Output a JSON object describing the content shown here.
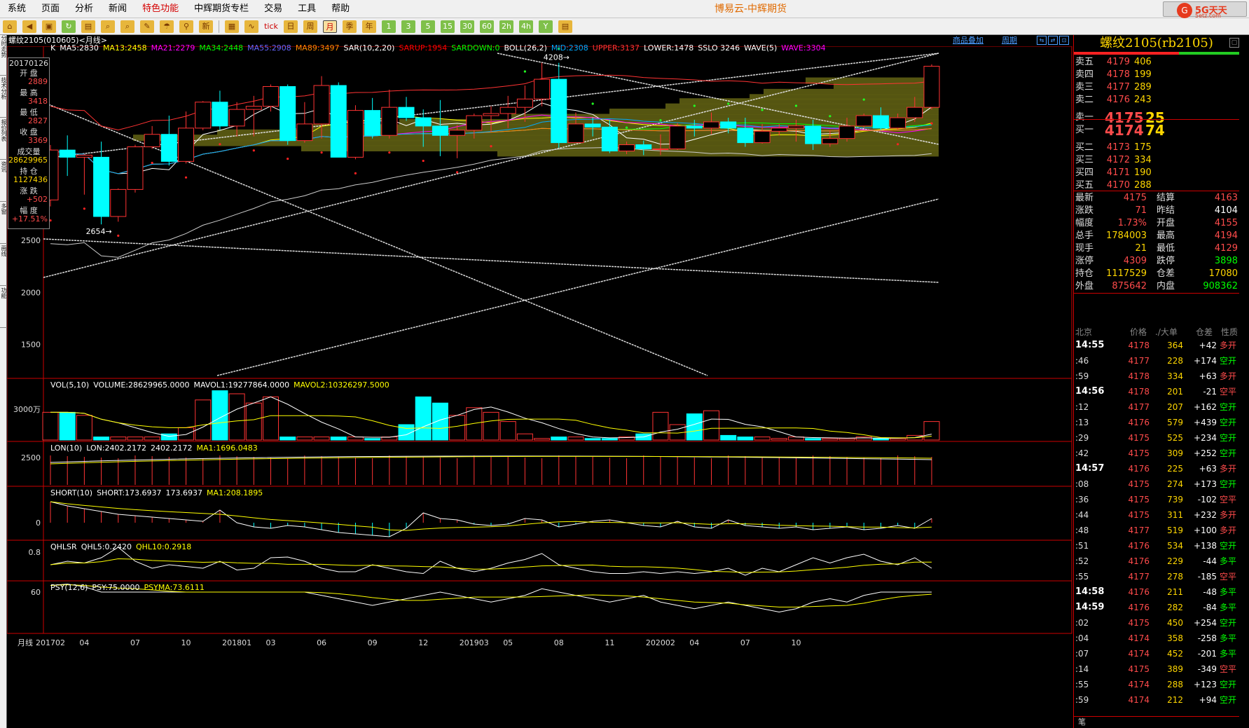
{
  "menu": [
    "系统",
    "页面",
    "分析",
    "新闻",
    "特色功能",
    "中辉期货专栏",
    "交易",
    "工具",
    "帮助"
  ],
  "app_title": "博易云-中辉期货",
  "brand": {
    "name": "5G天天",
    "url": "5etz.com",
    "logo_letter": "G"
  },
  "toolbar": [
    "⌂",
    "◀",
    "▣",
    "↻",
    "▤",
    "⌕",
    "⌕",
    "✎",
    "☂",
    "⚲",
    "新",
    "▦",
    "∿",
    "tick",
    "日",
    "周",
    "月",
    "季",
    "年",
    "1",
    "3",
    "5",
    "15",
    "30",
    "60",
    "2h",
    "4h",
    "Y",
    "▤"
  ],
  "chart_header": {
    "contract_tag": "螺纹2105(010605)<月线>",
    "overlay_link": "商品叠加",
    "period_link": "周期",
    "nav": [
      "⇆",
      "⇄",
      "⊡"
    ]
  },
  "left_tabs": [
    "分时走势",
    "技术分析",
    "报价列表",
    "资讯",
    "多窗",
    "画线",
    "功能"
  ],
  "info_panel": {
    "date": "20170126",
    "rows": [
      {
        "label": "开 盘",
        "value": "2889"
      },
      {
        "label": "最 高",
        "value": "3418"
      },
      {
        "label": "最 低",
        "value": "2827"
      },
      {
        "label": "收 盘",
        "value": "3369"
      },
      {
        "label": "成交量",
        "value": "28629965"
      },
      {
        "label": "持 仓",
        "value": "1127436"
      },
      {
        "label": "涨 跌",
        "value": "+502"
      },
      {
        "label": "幅 度",
        "value": "+17.51%"
      }
    ]
  },
  "indicators": {
    "main": [
      {
        "text": "K",
        "color": "#ffffff"
      },
      {
        "text": "MA5:2830",
        "color": "#ffffff"
      },
      {
        "text": "MA13:2458",
        "color": "#ffff00"
      },
      {
        "text": "MA21:2279",
        "color": "#ff00ff"
      },
      {
        "text": "MA34:2448",
        "color": "#00ff00"
      },
      {
        "text": "MA55:2908",
        "color": "#6666ff"
      },
      {
        "text": "MA89:3497",
        "color": "#ff8800"
      },
      {
        "text": "SAR(10,2,20)",
        "color": "#ffffff"
      },
      {
        "text": "SARUP:1954",
        "color": "#ff0000"
      },
      {
        "text": "SARDOWN:0",
        "color": "#00ff00"
      },
      {
        "text": "BOLL(26,2)",
        "color": "#ffffff"
      },
      {
        "text": "MID:2308",
        "color": "#00aaff"
      },
      {
        "text": "UPPER:3137",
        "color": "#ff3333"
      },
      {
        "text": "LOWER:1478",
        "color": "#ffffff"
      },
      {
        "text": "SSLO 3246",
        "color": "#ffffff"
      },
      {
        "text": "WAVE(5)",
        "color": "#ffffff"
      },
      {
        "text": "WAVE:3304",
        "color": "#ff00ff"
      }
    ],
    "vol": [
      {
        "text": "VOL(5,10)",
        "color": "#ffffff"
      },
      {
        "text": "VOLUME:28629965.0000",
        "color": "#ffffff"
      },
      {
        "text": "MAVOL1:19277864.0000",
        "color": "#ffffff"
      },
      {
        "text": "MAVOL2:10326297.5000",
        "color": "#ffff00"
      }
    ],
    "lon": [
      {
        "text": "LON(10)",
        "color": "#ffffff"
      },
      {
        "text": "LON:2402.2172",
        "color": "#ffffff"
      },
      {
        "text": "2402.2172",
        "color": "#ffffff"
      },
      {
        "text": "MA1:1696.0483",
        "color": "#ffff00"
      }
    ],
    "short": [
      {
        "text": "SHORT(10)",
        "color": "#ffffff"
      },
      {
        "text": "SHORT:173.6937",
        "color": "#ffffff"
      },
      {
        "text": "173.6937",
        "color": "#ffffff"
      },
      {
        "text": "MA1:208.1895",
        "color": "#ffff00"
      }
    ],
    "qhl": [
      {
        "text": "QHLSR",
        "color": "#ffffff"
      },
      {
        "text": "QHL5:0.2420",
        "color": "#ffffff"
      },
      {
        "text": "QHL10:0.2918",
        "color": "#ffff00"
      }
    ],
    "psy": [
      {
        "text": "PSY(12,6)",
        "color": "#ffffff"
      },
      {
        "text": "PSY:75.0000",
        "color": "#ffffff"
      },
      {
        "text": "PSYMA:73.6111",
        "color": "#ffff00"
      }
    ]
  },
  "chart_data": {
    "type": "candlestick",
    "period": "月线",
    "candles": [
      {
        "o": 2889,
        "h": 3418,
        "c": 3369,
        "l": 2827
      },
      {
        "o": 3369,
        "h": 3510,
        "c": 3300,
        "l": 3120
      },
      {
        "o": 3300,
        "h": 3330,
        "c": 3320,
        "l": 2940
      },
      {
        "o": 3300,
        "h": 3450,
        "c": 2730,
        "l": 2654
      },
      {
        "o": 2730,
        "h": 3000,
        "c": 2990,
        "l": 2680
      },
      {
        "o": 2990,
        "h": 3420,
        "c": 3400,
        "l": 2960
      },
      {
        "o": 3400,
        "h": 3600,
        "c": 3520,
        "l": 3380
      },
      {
        "o": 3520,
        "h": 3700,
        "c": 3260,
        "l": 3220
      },
      {
        "o": 3260,
        "h": 3740,
        "c": 3580,
        "l": 3240
      },
      {
        "o": 3580,
        "h": 3840,
        "c": 3830,
        "l": 3560
      },
      {
        "o": 3830,
        "h": 3940,
        "c": 3600,
        "l": 3560
      },
      {
        "o": 3600,
        "h": 3830,
        "c": 3760,
        "l": 3500
      },
      {
        "o": 3760,
        "h": 3890,
        "c": 3790,
        "l": 3500
      },
      {
        "o": 3790,
        "h": 4000,
        "c": 3980,
        "l": 3740
      },
      {
        "o": 3980,
        "h": 4000,
        "c": 3460,
        "l": 3420
      },
      {
        "o": 3460,
        "h": 3830,
        "c": 3620,
        "l": 3440
      },
      {
        "o": 3620,
        "h": 4080,
        "c": 3990,
        "l": 3480
      },
      {
        "o": 3990,
        "h": 4020,
        "c": 3300,
        "l": 3320
      },
      {
        "o": 3300,
        "h": 3800,
        "c": 3750,
        "l": 3280
      },
      {
        "o": 3750,
        "h": 3870,
        "c": 3510,
        "l": 3480
      },
      {
        "o": 3510,
        "h": 3950,
        "c": 3780,
        "l": 3480
      },
      {
        "o": 3780,
        "h": 3880,
        "c": 3680,
        "l": 3650
      },
      {
        "o": 3680,
        "h": 3760,
        "c": 3600,
        "l": 3400
      },
      {
        "o": 3600,
        "h": 3850,
        "c": 3510,
        "l": 3310
      },
      {
        "o": 3510,
        "h": 3610,
        "c": 3560,
        "l": 3290
      },
      {
        "o": 3560,
        "h": 3720,
        "c": 3700,
        "l": 3480
      },
      {
        "o": 3700,
        "h": 3790,
        "c": 3720,
        "l": 3540
      },
      {
        "o": 3720,
        "h": 3890,
        "c": 3780,
        "l": 3580
      },
      {
        "o": 3780,
        "h": 3990,
        "c": 3860,
        "l": 3640
      },
      {
        "o": 3860,
        "h": 4208,
        "c": 4050,
        "l": 3790
      },
      {
        "o": 4050,
        "h": 4208,
        "c": 3440,
        "l": 3390
      },
      {
        "o": 3440,
        "h": 3730,
        "c": 3620,
        "l": 3440
      },
      {
        "o": 3620,
        "h": 3680,
        "c": 3590,
        "l": 3500
      },
      {
        "o": 3590,
        "h": 3660,
        "c": 3360,
        "l": 3340
      },
      {
        "o": 3360,
        "h": 3450,
        "c": 3420,
        "l": 3330
      },
      {
        "o": 3420,
        "h": 3460,
        "c": 3380,
        "l": 3320
      },
      {
        "o": 3380,
        "h": 3520,
        "c": 3380,
        "l": 3320
      },
      {
        "o": 3380,
        "h": 3630,
        "c": 3600,
        "l": 3370
      },
      {
        "o": 3600,
        "h": 3660,
        "c": 3580,
        "l": 3500
      },
      {
        "o": 3580,
        "h": 3730,
        "c": 3640,
        "l": 3520
      },
      {
        "o": 3640,
        "h": 3680,
        "c": 3580,
        "l": 3530
      },
      {
        "o": 3580,
        "h": 3680,
        "c": 3440,
        "l": 3400
      },
      {
        "o": 3440,
        "h": 3620,
        "c": 3550,
        "l": 3430
      },
      {
        "o": 3550,
        "h": 3620,
        "c": 3580,
        "l": 3510
      },
      {
        "o": 3580,
        "h": 3660,
        "c": 3600,
        "l": 3450
      },
      {
        "o": 3600,
        "h": 3660,
        "c": 3430,
        "l": 3370
      },
      {
        "o": 3430,
        "h": 3560,
        "c": 3480,
        "l": 3400
      },
      {
        "o": 3480,
        "h": 3680,
        "c": 3600,
        "l": 3450
      },
      {
        "o": 3600,
        "h": 3720,
        "c": 3700,
        "l": 3580
      },
      {
        "o": 3700,
        "h": 3780,
        "c": 3580,
        "l": 3560
      },
      {
        "o": 3580,
        "h": 3720,
        "c": 3680,
        "l": 3560
      },
      {
        "o": 3680,
        "h": 3880,
        "c": 3780,
        "l": 3640
      },
      {
        "o": 3780,
        "h": 4194,
        "c": 4175,
        "l": 3760
      }
    ],
    "annotations": [
      {
        "text": "4208→",
        "index": 30
      },
      {
        "text": "2654→",
        "index": 3
      }
    ],
    "y_ticks": [
      "2500",
      "2000",
      "1500"
    ],
    "vol_tick": "3000万",
    "lon_tick": "2500",
    "short_tick": "0",
    "qhl_tick": "0.8",
    "psy_tick": "60",
    "x_labels": [
      "201702",
      "04",
      "07",
      "10",
      "201801",
      "03",
      "06",
      "09",
      "12",
      "201903",
      "05",
      "08",
      "11",
      "202002",
      "04",
      "07",
      "10"
    ],
    "x_label_index": [
      0,
      2,
      5,
      8,
      11,
      13,
      16,
      19,
      22,
      25,
      27,
      30,
      33,
      36,
      38,
      41,
      44
    ],
    "period_label": "月线",
    "volumes": [
      18,
      18,
      16,
      2,
      2,
      2,
      2,
      4,
      8,
      26,
      32,
      30,
      24,
      28,
      2,
      2,
      2,
      2,
      2,
      1,
      2,
      10,
      28,
      24,
      16,
      21,
      18,
      12,
      4,
      1,
      2,
      2,
      1,
      1,
      2,
      4,
      18,
      10,
      17,
      19,
      3,
      2,
      2,
      1,
      2,
      1,
      1,
      1,
      2,
      1,
      1,
      3,
      12
    ]
  },
  "quote": {
    "title": "螺纹2105(rb2105)",
    "asks": [
      {
        "label": "卖五",
        "price": "4179",
        "vol": "406"
      },
      {
        "label": "卖四",
        "price": "4178",
        "vol": "199"
      },
      {
        "label": "卖三",
        "price": "4177",
        "vol": "289"
      },
      {
        "label": "卖二",
        "price": "4176",
        "vol": "243"
      },
      {
        "label": "卖一",
        "price": "4175",
        "vol": "25"
      }
    ],
    "bids": [
      {
        "label": "买一",
        "price": "4174",
        "vol": "74"
      },
      {
        "label": "买二",
        "price": "4173",
        "vol": "175"
      },
      {
        "label": "买三",
        "price": "4172",
        "vol": "334"
      },
      {
        "label": "买四",
        "price": "4171",
        "vol": "190"
      },
      {
        "label": "买五",
        "price": "4170",
        "vol": "288"
      }
    ],
    "stats": [
      {
        "l1": "最新",
        "v1": "4175",
        "c1": "#ff4b4b",
        "l2": "结算",
        "v2": "4163",
        "c2": "#ff4b4b"
      },
      {
        "l1": "涨跌",
        "v1": "71",
        "c1": "#ff4b4b",
        "l2": "昨结",
        "v2": "4104",
        "c2": "#ffffff"
      },
      {
        "l1": "幅度",
        "v1": "1.73%",
        "c1": "#ff4b4b",
        "l2": "开盘",
        "v2": "4155",
        "c2": "#ff4b4b"
      },
      {
        "l1": "总手",
        "v1": "1784003",
        "c1": "#ffd700",
        "l2": "最高",
        "v2": "4194",
        "c2": "#ff4b4b"
      },
      {
        "l1": "现手",
        "v1": "21",
        "c1": "#ffd700",
        "l2": "最低",
        "v2": "4129",
        "c2": "#ff4b4b"
      },
      {
        "l1": "涨停",
        "v1": "4309",
        "c1": "#ff4b4b",
        "l2": "跌停",
        "v2": "3898",
        "c2": "#00ff00"
      },
      {
        "l1": "持仓",
        "v1": "1117529",
        "c1": "#ffd700",
        "l2": "仓差",
        "v2": "17080",
        "c2": "#ffd700"
      },
      {
        "l1": "外盘",
        "v1": "875642",
        "c1": "#ff4b4b",
        "l2": "内盘",
        "v2": "908362",
        "c2": "#00ff00"
      }
    ],
    "ticks_header": {
      "c1": "北京",
      "c2": "价格",
      "c3": "./大单",
      "c4": "仓差",
      "c5": "性质"
    },
    "ticks": [
      {
        "t": "14:55",
        "bold": true,
        "p": "4178",
        "v": "364",
        "oi": "+42",
        "n": "多开",
        "nc": "#ff4b4b"
      },
      {
        "t": ":46",
        "bold": false,
        "p": "4177",
        "v": "228",
        "oi": "+174",
        "n": "空开",
        "nc": "#00ff00"
      },
      {
        "t": ":59",
        "bold": false,
        "p": "4178",
        "v": "334",
        "oi": "+63",
        "n": "多开",
        "nc": "#ff4b4b"
      },
      {
        "t": "14:56",
        "bold": true,
        "p": "4178",
        "v": "201",
        "oi": "-21",
        "n": "空平",
        "nc": "#ff4b4b"
      },
      {
        "t": ":12",
        "bold": false,
        "p": "4177",
        "v": "207",
        "oi": "+162",
        "n": "空开",
        "nc": "#00ff00"
      },
      {
        "t": ":13",
        "bold": false,
        "p": "4176",
        "v": "579",
        "oi": "+439",
        "n": "空开",
        "nc": "#00ff00"
      },
      {
        "t": ":29",
        "bold": false,
        "p": "4175",
        "v": "525",
        "oi": "+234",
        "n": "空开",
        "nc": "#00ff00"
      },
      {
        "t": ":42",
        "bold": false,
        "p": "4175",
        "v": "309",
        "oi": "+252",
        "n": "空开",
        "nc": "#00ff00"
      },
      {
        "t": "14:57",
        "bold": true,
        "p": "4176",
        "v": "225",
        "oi": "+63",
        "n": "多开",
        "nc": "#ff4b4b"
      },
      {
        "t": ":08",
        "bold": false,
        "p": "4175",
        "v": "274",
        "oi": "+173",
        "n": "空开",
        "nc": "#00ff00"
      },
      {
        "t": ":36",
        "bold": false,
        "p": "4175",
        "v": "739",
        "oi": "-102",
        "n": "空平",
        "nc": "#ff4b4b"
      },
      {
        "t": ":44",
        "bold": false,
        "p": "4175",
        "v": "311",
        "oi": "+232",
        "n": "多开",
        "nc": "#ff4b4b"
      },
      {
        "t": ":48",
        "bold": false,
        "p": "4177",
        "v": "519",
        "oi": "+100",
        "n": "多开",
        "nc": "#ff4b4b"
      },
      {
        "t": ":51",
        "bold": false,
        "p": "4176",
        "v": "534",
        "oi": "+138",
        "n": "空开",
        "nc": "#00ff00"
      },
      {
        "t": ":52",
        "bold": false,
        "p": "4176",
        "v": "229",
        "oi": "-44",
        "n": "多平",
        "nc": "#00ff00"
      },
      {
        "t": ":55",
        "bold": false,
        "p": "4177",
        "v": "278",
        "oi": "-185",
        "n": "空平",
        "nc": "#ff4b4b"
      },
      {
        "t": "14:58",
        "bold": true,
        "p": "4176",
        "v": "211",
        "oi": "-48",
        "n": "多平",
        "nc": "#00ff00"
      },
      {
        "t": "14:59",
        "bold": true,
        "p": "4176",
        "v": "282",
        "oi": "-84",
        "n": "多平",
        "nc": "#00ff00"
      },
      {
        "t": ":02",
        "bold": false,
        "p": "4175",
        "v": "450",
        "oi": "+254",
        "n": "空开",
        "nc": "#00ff00"
      },
      {
        "t": ":04",
        "bold": false,
        "p": "4174",
        "v": "358",
        "oi": "-258",
        "n": "多平",
        "nc": "#00ff00"
      },
      {
        "t": ":07",
        "bold": false,
        "p": "4174",
        "v": "452",
        "oi": "-201",
        "n": "多平",
        "nc": "#00ff00"
      },
      {
        "t": ":14",
        "bold": false,
        "p": "4175",
        "v": "389",
        "oi": "-349",
        "n": "空平",
        "nc": "#ff4b4b"
      },
      {
        "t": ":55",
        "bold": false,
        "p": "4174",
        "v": "288",
        "oi": "+123",
        "n": "空开",
        "nc": "#00ff00"
      },
      {
        "t": ":59",
        "bold": false,
        "p": "4174",
        "v": "212",
        "oi": "+94",
        "n": "空开",
        "nc": "#00ff00"
      }
    ],
    "bottom_tab": "笔"
  }
}
